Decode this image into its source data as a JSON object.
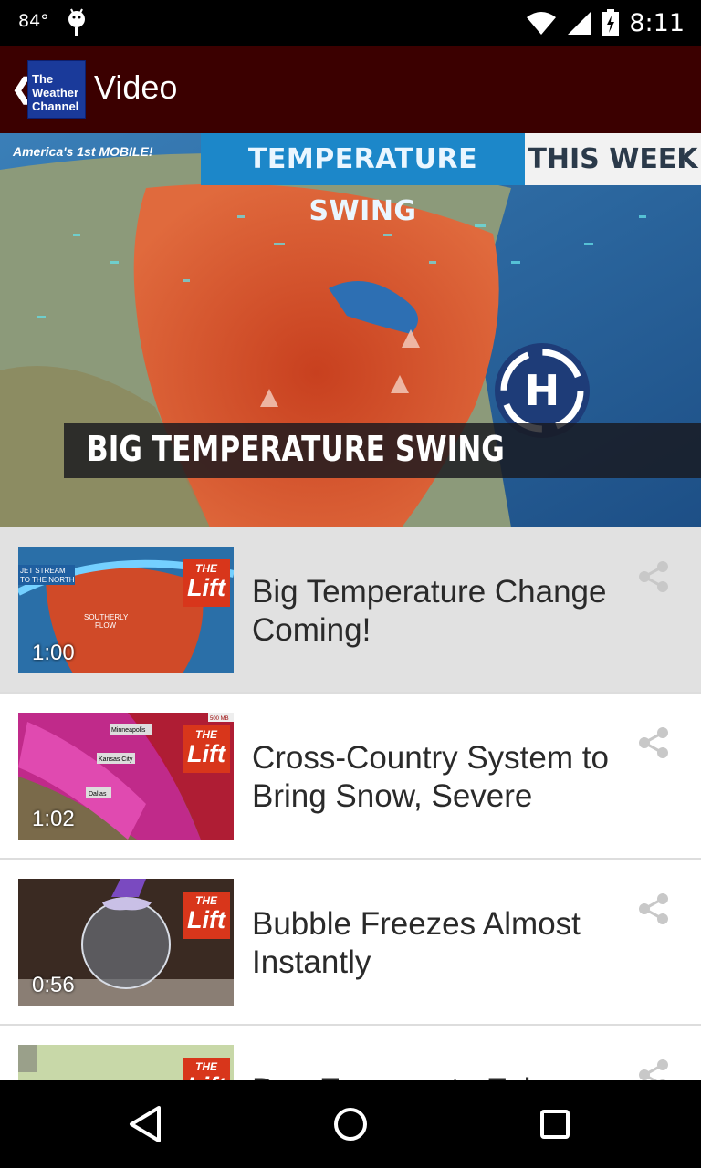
{
  "status_bar": {
    "temperature": "84°",
    "time": "8:11"
  },
  "app_bar": {
    "back_icon": "back-chevron-icon",
    "logo_text": [
      "The",
      "Weather",
      "Channel"
    ],
    "title": "Video"
  },
  "hero": {
    "badge_text": "America's 1st MOBILE!",
    "banner_left": "TEMPERATURE SWING",
    "banner_right": "THIS WEEK",
    "lower_third": "BIG TEMPERATURE SWING",
    "colors": {
      "heat": "#d04a28",
      "ocean": "#2b6aa6",
      "banner": "#1c87c9"
    }
  },
  "videos": [
    {
      "title": "Big Temperature Change Coming!",
      "duration": "1:00",
      "selected": true,
      "thumb_labels": [
        "JET STREAM TO THE NORTH",
        "SOUTHERLY FLOW"
      ]
    },
    {
      "title": "Cross-Country System to Bring Snow, Severe",
      "duration": "1:02",
      "selected": false,
      "thumb_labels": [
        "Minneapolis",
        "Kansas City",
        "Dallas",
        "500 MB"
      ]
    },
    {
      "title": "Bubble Freezes Almost Instantly",
      "duration": "0:56",
      "selected": false
    },
    {
      "title": "Dog Escapes to Exh",
      "duration": "",
      "selected": false
    }
  ],
  "lift_badge": {
    "line1": "THE",
    "line2": "Lift"
  },
  "share_icon": "share-icon",
  "nav_bar": {
    "back": "back-triangle-icon",
    "home": "home-circle-icon",
    "recents": "recents-square-icon"
  }
}
